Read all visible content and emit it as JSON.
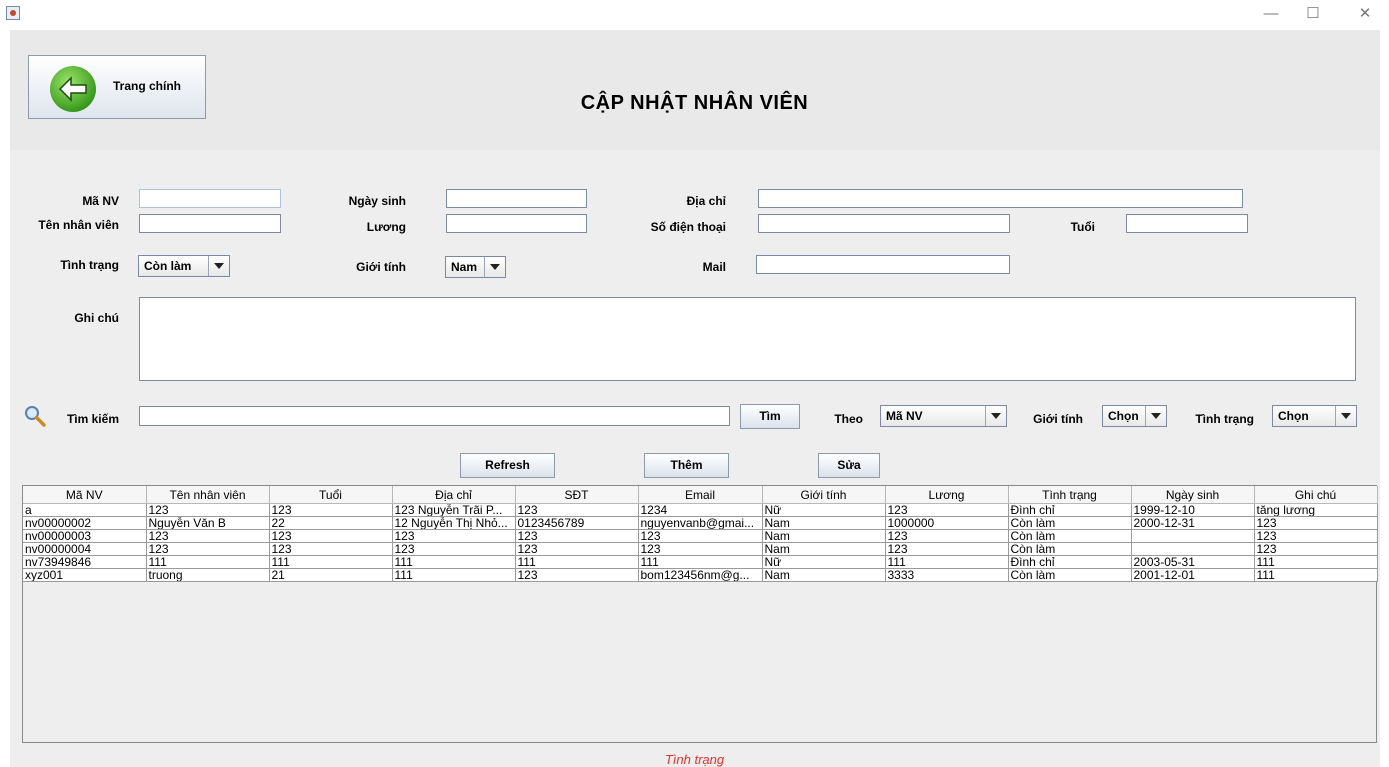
{
  "window": {
    "minimize": "—",
    "maximize": "☐",
    "close": "✕"
  },
  "header": {
    "home_label": "Trang chính",
    "title": "CẬP NHẬT NHÂN VIÊN"
  },
  "form": {
    "ma_nv": {
      "label": "Mã NV",
      "value": ""
    },
    "ten_nv": {
      "label": "Tên nhân viên",
      "value": ""
    },
    "tinh_trang": {
      "label": "Tình trạng",
      "selected": "Còn làm"
    },
    "ngay_sinh": {
      "label": "Ngày sinh",
      "value": ""
    },
    "luong": {
      "label": "Lương",
      "value": ""
    },
    "gioi_tinh": {
      "label": "Giới tính",
      "selected": "Nam"
    },
    "dia_chi": {
      "label": "Địa chỉ",
      "value": ""
    },
    "sdt": {
      "label": "Số điện thoại",
      "value": ""
    },
    "mail": {
      "label": "Mail",
      "value": ""
    },
    "tuoi": {
      "label": "Tuổi",
      "value": ""
    },
    "ghi_chu": {
      "label": "Ghi chú",
      "value": ""
    }
  },
  "search": {
    "label": "Tìm kiếm",
    "value": "",
    "button": "Tìm",
    "theo_label": "Theo",
    "theo_selected": "Mã NV",
    "gioi_tinh_label": "Giới tính",
    "gioi_tinh_selected": "Chọn",
    "tinh_trang_label": "Tình trạng",
    "tinh_trang_selected": "Chọn"
  },
  "actions": {
    "refresh": "Refresh",
    "them": "Thêm",
    "sua": "Sửa"
  },
  "table": {
    "columns": [
      "Mã NV",
      "Tên nhân viên",
      "Tuổi",
      "Địa chỉ",
      "SĐT",
      "Email",
      "Giới tính",
      "Lương",
      "Tình trạng",
      "Ngày sinh",
      "Ghi chú"
    ],
    "rows": [
      [
        "a",
        "123",
        "123",
        "123 Nguyễn Trãi P...",
        "123",
        "1234",
        "Nữ",
        "123",
        "Đình chỉ",
        "1999-12-10",
        "tăng lương"
      ],
      [
        "nv00000002",
        "Nguyễn Văn B",
        "22",
        "12 Nguyễn Thị Nhỏ...",
        "0123456789",
        "nguyenvanb@gmai...",
        "Nam",
        "1000000",
        "Còn làm",
        "2000-12-31",
        "123"
      ],
      [
        "nv00000003",
        "123",
        "123",
        "123",
        "123",
        "123",
        "Nam",
        "123",
        "Còn làm",
        "",
        "123"
      ],
      [
        "nv00000004",
        "123",
        "123",
        "123",
        "123",
        "123",
        "Nam",
        "123",
        "Còn làm",
        "",
        "123"
      ],
      [
        "nv73949846",
        "111",
        "111",
        "111",
        "111",
        "111",
        "Nữ",
        "111",
        "Đình chỉ",
        "2003-05-31",
        "111"
      ],
      [
        "xyz001",
        "truong",
        "21",
        "111",
        "123",
        "bom123456nm@g...",
        "Nam",
        "3333",
        "Còn làm",
        "2001-12-01",
        "111"
      ]
    ]
  },
  "status": "Tình trạng"
}
